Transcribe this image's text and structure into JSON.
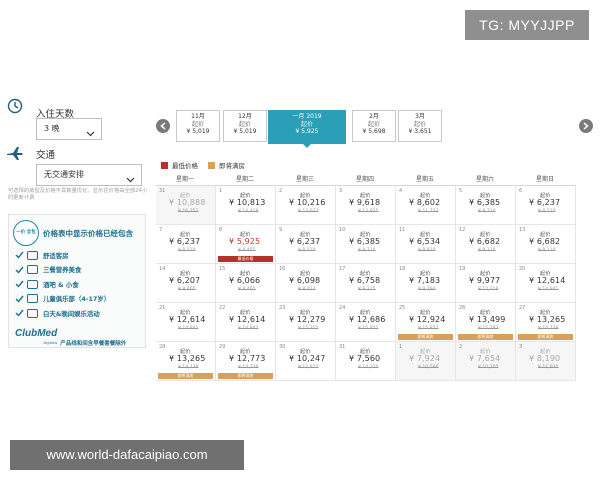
{
  "overlay": {
    "tg": "TG: MYYJJPP"
  },
  "stay": {
    "label": "入住天数",
    "value": "3 晚"
  },
  "transport": {
    "label": "交通",
    "value": "无交通安排"
  },
  "note": "可选择的房型及价格不具数量优化，显示在价格由全部24小时更新计费",
  "promo": {
    "seal": "一价 全包",
    "title": "价格表中显示价格已经包含",
    "items": [
      "舒适客房",
      "三餐营养美食",
      "酒吧 & 小食",
      "儿童俱乐部（4-17岁）",
      "白天&晚间娱乐活动"
    ],
    "logo": "ClubMed",
    "logo_sub": "Joyview",
    "foot": "产品线和间含早餐套餐除外"
  },
  "months": [
    {
      "name": "11月",
      "from": "起价",
      "price": "¥ 5,019"
    },
    {
      "name": "12月",
      "from": "起价",
      "price": "¥ 5,019"
    },
    {
      "name": "一月 2019",
      "from": "起价",
      "price": "¥ 5,925"
    },
    {
      "name": "2月",
      "from": "起价",
      "price": "¥ 5,698"
    },
    {
      "name": "3月",
      "from": "起价",
      "price": "¥ 3,651"
    }
  ],
  "legend": {
    "low": "最低价格",
    "soon": "即将满房"
  },
  "colors": {
    "accent": "#2a9fb7",
    "low": "#b5312c",
    "soon": "#d9a05b"
  },
  "weekdays": [
    "星期一",
    "星期二",
    "星期三",
    "星期四",
    "星期五",
    "星期六",
    "星期日"
  ],
  "days": [
    {
      "d": "31",
      "from": "起价",
      "price": "¥ 10,888",
      "orig": "¥ 16,352",
      "state": "grey"
    },
    {
      "d": "1",
      "from": "起价",
      "price": "¥ 10,813",
      "orig": "¥ 14,418",
      "state": ""
    },
    {
      "d": "2",
      "from": "起价",
      "price": "¥ 10,216",
      "orig": "¥ 13,622",
      "state": ""
    },
    {
      "d": "3",
      "from": "起价",
      "price": "¥ 9,618",
      "orig": "¥ 12,825",
      "state": ""
    },
    {
      "d": "4",
      "from": "起价",
      "price": "¥ 8,602",
      "orig": "¥ 11,732",
      "state": ""
    },
    {
      "d": "5",
      "from": "起价",
      "price": "¥ 6,385",
      "orig": "¥ 8,710",
      "state": ""
    },
    {
      "d": "6",
      "from": "起价",
      "price": "¥ 6,237",
      "orig": "¥ 8,510",
      "state": ""
    },
    {
      "d": "7",
      "from": "起价",
      "price": "¥ 6,237",
      "orig": "¥ 8,510",
      "state": ""
    },
    {
      "d": "8",
      "from": "起价",
      "price": "¥ 5,925",
      "orig": "¥ 8,465",
      "state": "low",
      "tag": "最低价格"
    },
    {
      "d": "9",
      "from": "起价",
      "price": "¥ 6,237",
      "orig": "¥ 8,510",
      "state": ""
    },
    {
      "d": "10",
      "from": "起价",
      "price": "¥ 6,385",
      "orig": "¥ 8,710",
      "state": ""
    },
    {
      "d": "11",
      "from": "起价",
      "price": "¥ 6,534",
      "orig": "¥ 8,910",
      "state": ""
    },
    {
      "d": "12",
      "from": "起价",
      "price": "¥ 6,682",
      "orig": "¥ 9,110",
      "state": ""
    },
    {
      "d": "13",
      "from": "起价",
      "price": "¥ 6,682",
      "orig": "¥ 9,110",
      "state": ""
    },
    {
      "d": "14",
      "from": "起价",
      "price": "¥ 6,207",
      "orig": "¥ 8,465",
      "state": ""
    },
    {
      "d": "15",
      "from": "起价",
      "price": "¥ 6,066",
      "orig": "¥ 8,465",
      "state": ""
    },
    {
      "d": "16",
      "from": "起价",
      "price": "¥ 6,098",
      "orig": "¥ 8,312",
      "state": ""
    },
    {
      "d": "17",
      "from": "起价",
      "price": "¥ 6,758",
      "orig": "¥ 9,215",
      "state": ""
    },
    {
      "d": "18",
      "from": "起价",
      "price": "¥ 7,183",
      "orig": "¥ 9,793",
      "state": ""
    },
    {
      "d": "19",
      "from": "起价",
      "price": "¥ 9,977",
      "orig": "¥ 12,218",
      "state": ""
    },
    {
      "d": "20",
      "from": "起价",
      "price": "¥ 12,614",
      "orig": "¥ 14,841",
      "state": ""
    },
    {
      "d": "21",
      "from": "起价",
      "price": "¥ 12,614",
      "orig": "¥ 14,841",
      "state": ""
    },
    {
      "d": "22",
      "from": "起价",
      "price": "¥ 12,614",
      "orig": "¥ 14,841",
      "state": ""
    },
    {
      "d": "23",
      "from": "起价",
      "price": "¥ 12,279",
      "orig": "¥ 15,351",
      "state": ""
    },
    {
      "d": "24",
      "from": "起价",
      "price": "¥ 12,686",
      "orig": "¥ 15,851",
      "state": ""
    },
    {
      "d": "25",
      "from": "起价",
      "price": "¥ 12,924",
      "orig": "¥ 15,827",
      "state": "soon",
      "tag": "即将满房"
    },
    {
      "d": "26",
      "from": "起价",
      "price": "¥ 13,499",
      "orig": "¥ 15,283",
      "state": "soon",
      "tag": "即将满房"
    },
    {
      "d": "27",
      "from": "起价",
      "price": "¥ 13,265",
      "orig": "¥ 14,739",
      "state": "soon",
      "tag": "即将满房"
    },
    {
      "d": "28",
      "from": "起价",
      "price": "¥ 13,265",
      "orig": "¥ 14,739",
      "state": "soon",
      "tag": "即将满房"
    },
    {
      "d": "29",
      "from": "起价",
      "price": "¥ 12,773",
      "orig": "¥ 14,739",
      "state": "soon",
      "tag": "即将满房"
    },
    {
      "d": "30",
      "from": "起价",
      "price": "¥ 10,247",
      "orig": "¥ 12,812",
      "state": ""
    },
    {
      "d": "31",
      "from": "起价",
      "price": "¥ 7,560",
      "orig": "¥ 10,310",
      "state": ""
    },
    {
      "d": "1",
      "from": "起价",
      "price": "¥ 7,924",
      "orig": "¥ 10,566",
      "state": "grey"
    },
    {
      "d": "2",
      "from": "起价",
      "price": "¥ 7,654",
      "orig": "¥ 10,205",
      "state": "grey"
    },
    {
      "d": "3",
      "from": "起价",
      "price": "¥ 8,190",
      "orig": "¥ 11,920",
      "state": "grey"
    }
  ],
  "watermark": "www.world-dafacaipiao.com"
}
